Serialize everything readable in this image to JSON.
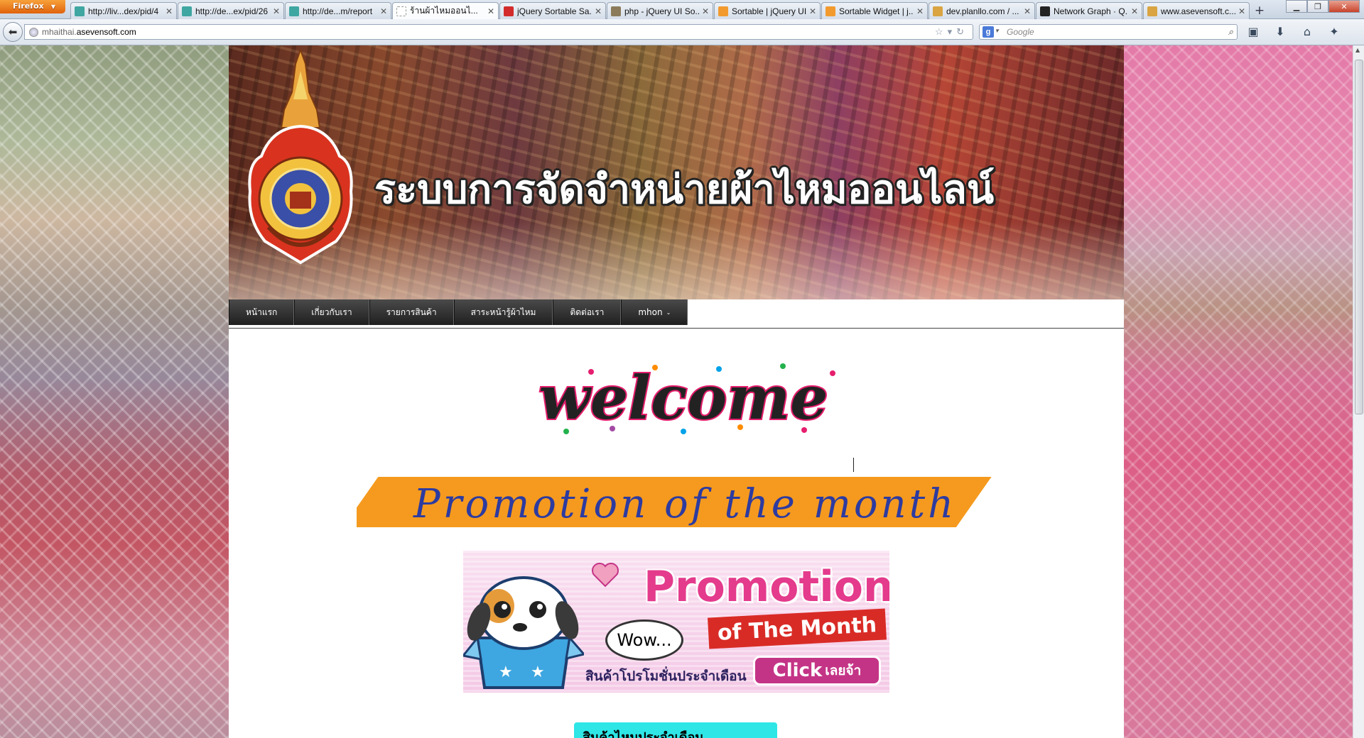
{
  "browser": {
    "app_button": "Firefox",
    "tabs": [
      {
        "title": "http://liv...dex/pid/4",
        "favicon": "#3fa6a1"
      },
      {
        "title": "http://de...ex/pid/26",
        "favicon": "#3fa6a1"
      },
      {
        "title": "http://de...m/report",
        "favicon": "#3fa6a1"
      },
      {
        "title": "ร้านผ้าไหมออนไ...",
        "favicon": "#ffffff"
      },
      {
        "title": "jQuery Sortable Sa...",
        "favicon": "#d32b2b"
      },
      {
        "title": "php - jQuery UI So...",
        "favicon": "#8b7b5a"
      },
      {
        "title": "Sortable | jQuery UI",
        "favicon": "#f29a2e"
      },
      {
        "title": "Sortable Widget | j...",
        "favicon": "#f29a2e"
      },
      {
        "title": "dev.planllo.com / ...",
        "favicon": "#d9a441"
      },
      {
        "title": "Network Graph · Q...",
        "favicon": "#222222"
      },
      {
        "title": "www.asevensoft.c...",
        "favicon": "#d9a441"
      }
    ],
    "active_tab_index": 3,
    "url_prefix": "mhaithai.",
    "url_host": "asevensoft.com",
    "search_placeholder": "Google"
  },
  "site": {
    "banner_title": "ระบบการจัดจำหน่ายผ้าไหมออนไลน์",
    "menu": [
      {
        "label": "หน้าแรก"
      },
      {
        "label": "เกี่ยวกับเรา"
      },
      {
        "label": "รายการสินค้า"
      },
      {
        "label": "สาระหน้ารู้ผ้าไหม"
      },
      {
        "label": "ติดต่อเรา"
      },
      {
        "label": "mhon"
      }
    ],
    "welcome_text": "welcome",
    "promo_strip_text": "Promotion of the month",
    "promo_box": {
      "title": "Promotion",
      "subtitle": "of The Month",
      "bubble": "Wow...",
      "caption": "สินค้าโปรโมชั่นประจำเดือน",
      "button_main": "Click",
      "button_thai": "เลยจ้า"
    },
    "cyan_box_text": "สินค้าไหมประจำเดือน"
  },
  "colors": {
    "menu_bg": "#2a2a2a",
    "promo_strip": "#f59a1e",
    "promo_text": "#2d3ba0",
    "promo_pink": "#e43b8c",
    "cyan": "#2ee6e6"
  }
}
